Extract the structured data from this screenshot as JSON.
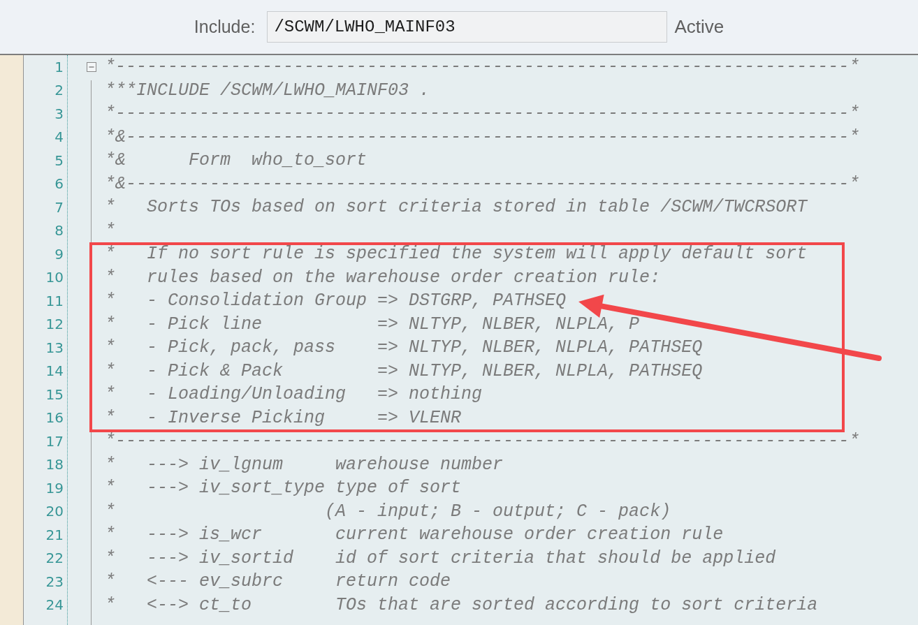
{
  "header": {
    "label": "Include:",
    "field_value": "/SCWM/LWHO_MAINF03",
    "status": "Active"
  },
  "editor": {
    "fold": {
      "expanded": true
    },
    "blocks": [
      {
        "highlighted": false,
        "lines": [
          {
            "number": "1",
            "text": "*----------------------------------------------------------------------*",
            "arrow": false
          },
          {
            "number": "2",
            "text": "***INCLUDE /SCWM/LWHO_MAINF03 .",
            "arrow": false
          },
          {
            "number": "3",
            "text": "*----------------------------------------------------------------------*",
            "arrow": false
          },
          {
            "number": "4",
            "text": "*&---------------------------------------------------------------------*",
            "arrow": false
          },
          {
            "number": "5",
            "text": "*&      Form  who_to_sort",
            "arrow": false
          },
          {
            "number": "6",
            "text": "*&---------------------------------------------------------------------*",
            "arrow": false
          },
          {
            "number": "7",
            "text": "*   Sorts TOs based on sort criteria stored in table /SCWM/TWCRSORT",
            "arrow": false
          },
          {
            "number": "8",
            "text": "*",
            "arrow": false
          }
        ]
      },
      {
        "highlighted": true,
        "lines": [
          {
            "number": "9",
            "text": "*   If no sort rule is specified the system will apply default sort",
            "arrow": false
          },
          {
            "number": "10",
            "text": "*   rules based on the warehouse order creation rule:",
            "arrow": false
          },
          {
            "number": "11",
            "text": "*   - Consolidation Group => DSTGRP, PATHSEQ",
            "arrow": true
          },
          {
            "number": "12",
            "text": "*   - Pick line           => NLTYP, NLBER, NLPLA, P",
            "arrow": false
          },
          {
            "number": "13",
            "text": "*   - Pick, pack, pass    => NLTYP, NLBER, NLPLA, PATHSEQ",
            "arrow": false
          },
          {
            "number": "14",
            "text": "*   - Pick & Pack         => NLTYP, NLBER, NLPLA, PATHSEQ",
            "arrow": false
          },
          {
            "number": "15",
            "text": "*   - Loading/Unloading   => nothing",
            "arrow": false
          },
          {
            "number": "16",
            "text": "*   - Inverse Picking     => VLENR",
            "arrow": false
          }
        ]
      },
      {
        "highlighted": false,
        "lines": [
          {
            "number": "17",
            "text": "*----------------------------------------------------------------------*",
            "arrow": false
          },
          {
            "number": "18",
            "text": "*   ---> iv_lgnum     warehouse number",
            "arrow": false
          },
          {
            "number": "19",
            "text": "*   ---> iv_sort_type type of sort",
            "arrow": false
          },
          {
            "number": "20",
            "text": "*                    (A - input; B - output; C - pack)",
            "arrow": false
          },
          {
            "number": "21",
            "text": "*   ---> is_wcr       current warehouse order creation rule",
            "arrow": false
          },
          {
            "number": "22",
            "text": "*   ---> iv_sortid    id of sort criteria that should be applied",
            "arrow": false
          },
          {
            "number": "23",
            "text": "*   <--- ev_subrc     return code",
            "arrow": false
          },
          {
            "number": "24",
            "text": "*   <--> ct_to        TOs that are sorted according to sort criteria",
            "arrow": false
          }
        ]
      }
    ]
  }
}
